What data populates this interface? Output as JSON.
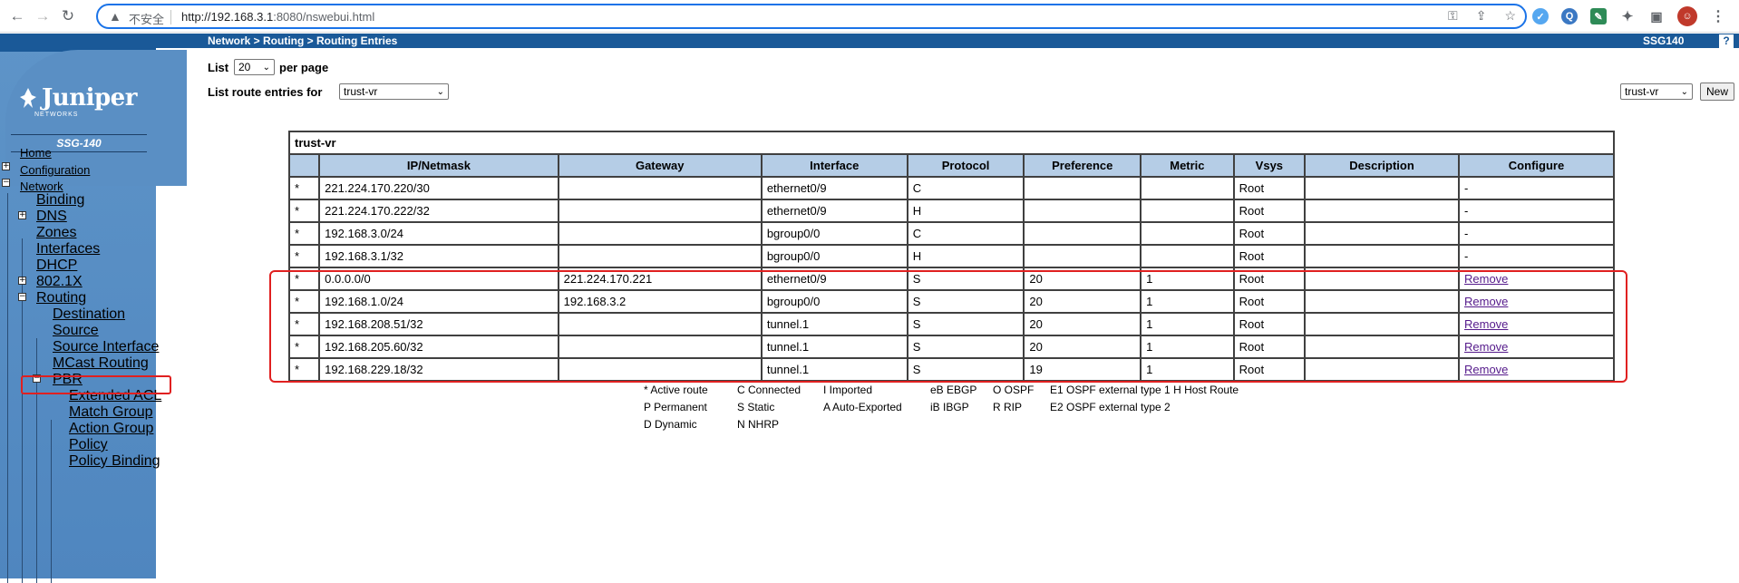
{
  "browser": {
    "security": "不安全",
    "url_host": "http://192.168.3.1",
    "url_rest": ":8080/nswebui.html"
  },
  "header": {
    "breadcrumb": "Network > Routing > Routing Entries",
    "device": "SSG140",
    "help": "?"
  },
  "sidebar": {
    "brand": "Juniper",
    "brand_sub": "NETWORKS",
    "model": "SSG-140",
    "items": {
      "home": "Home",
      "configuration": "Configuration",
      "network": "Network",
      "binding": "Binding",
      "dns": "DNS",
      "zones": "Zones",
      "interfaces": "Interfaces",
      "dhcp": "DHCP",
      "dot1x": "802.1X",
      "routing": "Routing",
      "destination": "Destination",
      "source": "Source",
      "source_interface": "Source Interface",
      "mcast_routing": "MCast Routing",
      "pbr": "PBR",
      "extended_acl": "Extended ACL",
      "match_group": "Match Group",
      "action_group": "Action Group",
      "policy": "Policy",
      "policy_binding": "Policy Binding"
    }
  },
  "controls": {
    "list_label": "List",
    "list_value": "20",
    "per_page": "per page",
    "list_for_label": "List route entries for",
    "vr_value": "trust-vr",
    "vr_value_right": "trust-vr",
    "new_button": "New"
  },
  "table": {
    "caption": "trust-vr",
    "columns": [
      "IP/Netmask",
      "Gateway",
      "Interface",
      "Protocol",
      "Preference",
      "Metric",
      "Vsys",
      "Description",
      "Configure"
    ],
    "rows": [
      {
        "flag": "*",
        "ip": "221.224.170.220/30",
        "gateway": "",
        "iface": "ethernet0/9",
        "proto": "C",
        "pref": "",
        "metric": "",
        "vsys": "Root",
        "desc": "",
        "config": "-"
      },
      {
        "flag": "*",
        "ip": "221.224.170.222/32",
        "gateway": "",
        "iface": "ethernet0/9",
        "proto": "H",
        "pref": "",
        "metric": "",
        "vsys": "Root",
        "desc": "",
        "config": "-"
      },
      {
        "flag": "*",
        "ip": "192.168.3.0/24",
        "gateway": "",
        "iface": "bgroup0/0",
        "proto": "C",
        "pref": "",
        "metric": "",
        "vsys": "Root",
        "desc": "",
        "config": "-"
      },
      {
        "flag": "*",
        "ip": "192.168.3.1/32",
        "gateway": "",
        "iface": "bgroup0/0",
        "proto": "H",
        "pref": "",
        "metric": "",
        "vsys": "Root",
        "desc": "",
        "config": "-"
      },
      {
        "flag": "*",
        "ip": "0.0.0.0/0",
        "gateway": "221.224.170.221",
        "iface": "ethernet0/9",
        "proto": "S",
        "pref": "20",
        "metric": "1",
        "vsys": "Root",
        "desc": "",
        "config": "Remove"
      },
      {
        "flag": "*",
        "ip": "192.168.1.0/24",
        "gateway": "192.168.3.2",
        "iface": "bgroup0/0",
        "proto": "S",
        "pref": "20",
        "metric": "1",
        "vsys": "Root",
        "desc": "",
        "config": "Remove"
      },
      {
        "flag": "*",
        "ip": "192.168.208.51/32",
        "gateway": "",
        "iface": "tunnel.1",
        "proto": "S",
        "pref": "20",
        "metric": "1",
        "vsys": "Root",
        "desc": "",
        "config": "Remove"
      },
      {
        "flag": "*",
        "ip": "192.168.205.60/32",
        "gateway": "",
        "iface": "tunnel.1",
        "proto": "S",
        "pref": "20",
        "metric": "1",
        "vsys": "Root",
        "desc": "",
        "config": "Remove"
      },
      {
        "flag": "*",
        "ip": "192.168.229.18/32",
        "gateway": "",
        "iface": "tunnel.1",
        "proto": "S",
        "pref": "19",
        "metric": "1",
        "vsys": "Root",
        "desc": "",
        "config": "Remove"
      }
    ]
  },
  "legend": {
    "r1": [
      "* Active route",
      "C Connected",
      "I  Imported",
      "eB EBGP",
      "O OSPF",
      "E1 OSPF external type 1 H Host Route"
    ],
    "r2": [
      "P Permanent",
      "S Static",
      "A Auto-Exported",
      "iB  IBGP",
      "R RIP",
      "E2 OSPF external type 2"
    ],
    "r3": [
      "D Dynamic",
      "N NHRP"
    ]
  },
  "colors": {
    "header_bar": "#1a5998",
    "sidebar": "#5e94c8",
    "table_header": "#b5cde6",
    "highlight": "#e02020"
  }
}
